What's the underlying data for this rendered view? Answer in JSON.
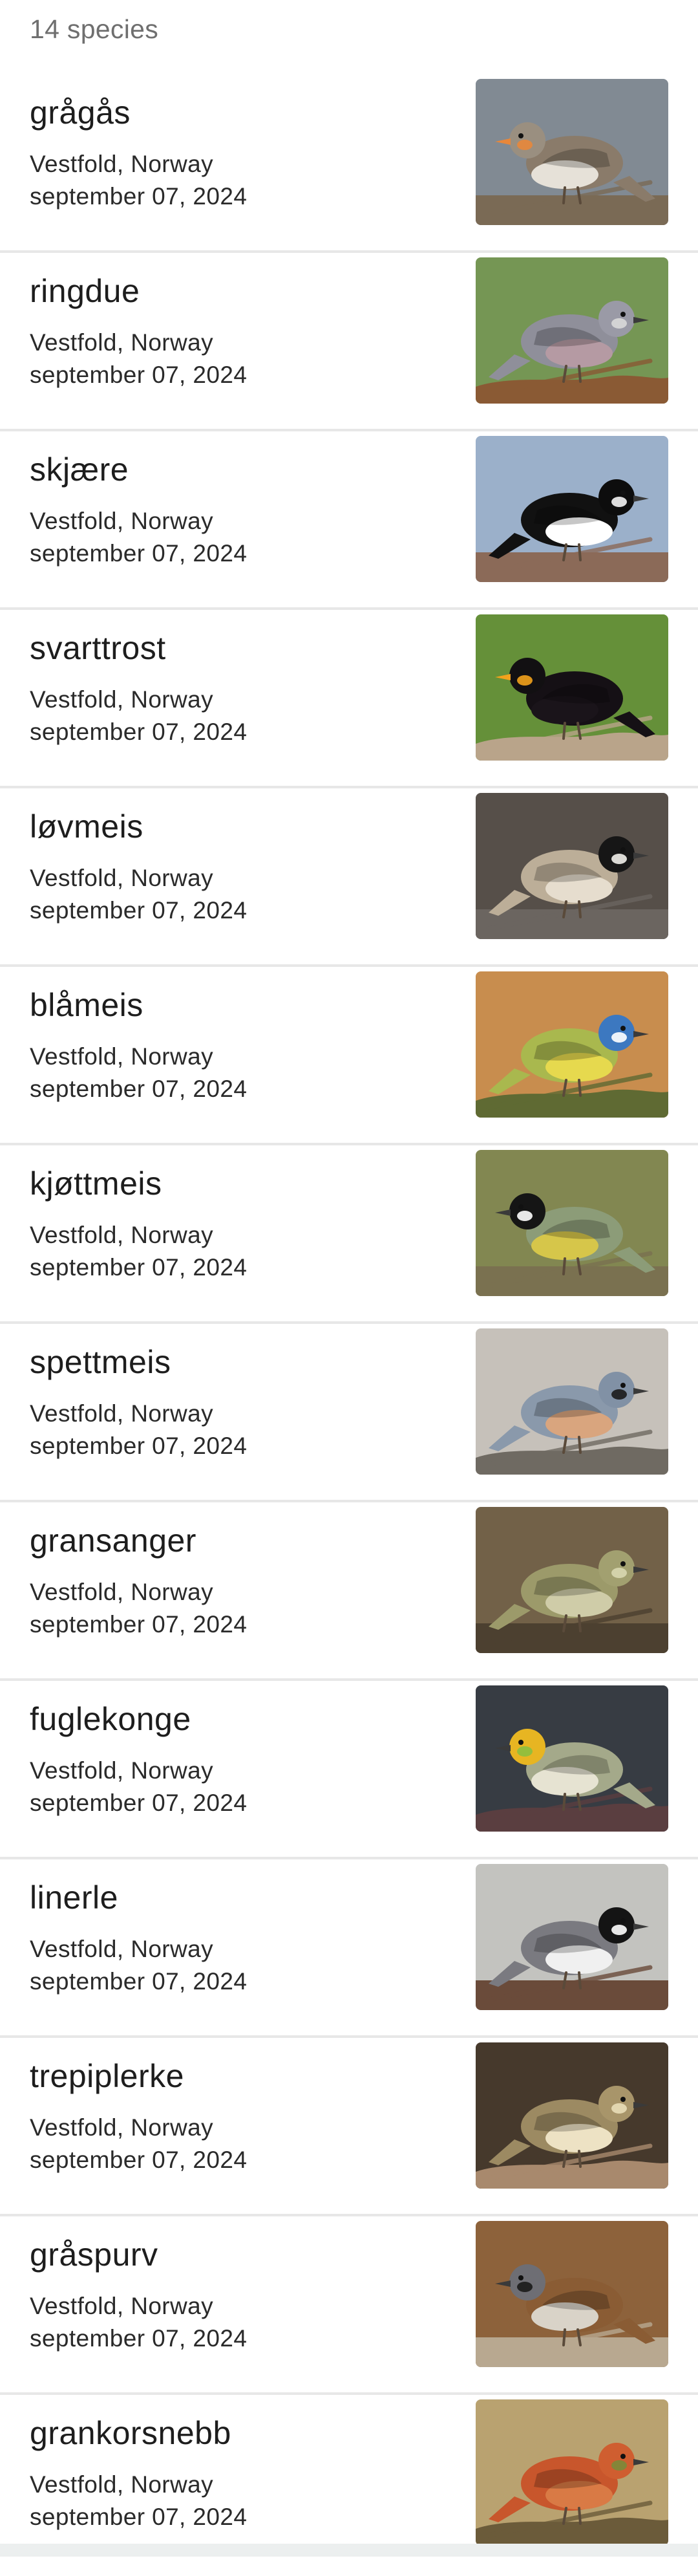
{
  "header": {
    "species_count": "14 species"
  },
  "species": [
    {
      "name": "grågås",
      "location": "Vestfold, Norway",
      "date": "september 07, 2024",
      "photo_icon": "greylag-goose-photo",
      "bg": "#8d96a0",
      "ground": "#7a6a55",
      "body": "#8a7b6a",
      "head": "#9a8f80",
      "accent": "#e8873a",
      "belly": "#e6e1d8"
    },
    {
      "name": "ringdue",
      "location": "Vestfold, Norway",
      "date": "september 07, 2024",
      "photo_icon": "wood-pigeon-photo",
      "bg": "#7fa35c",
      "ground": "#8a5a34",
      "body": "#8f8f9a",
      "head": "#9a9aa6",
      "accent": "#d9d9d9",
      "belly": "#b59aa3"
    },
    {
      "name": "skjære",
      "location": "Vestfold, Norway",
      "date": "september 07, 2024",
      "photo_icon": "magpie-photo",
      "bg": "#a9bfdc",
      "ground": "#8b6a58",
      "body": "#111111",
      "head": "#0d0d0d",
      "accent": "#f4f4f4",
      "belly": "#ffffff"
    },
    {
      "name": "svarttrost",
      "location": "Vestfold, Norway",
      "date": "september 07, 2024",
      "photo_icon": "blackbird-photo",
      "bg": "#6e9d3e",
      "ground": "#b9a48a",
      "body": "#151015",
      "head": "#121012",
      "accent": "#f2a21c",
      "belly": "#1a141a"
    },
    {
      "name": "løvmeis",
      "location": "Vestfold, Norway",
      "date": "september 07, 2024",
      "photo_icon": "marsh-tit-photo",
      "bg": "#5e5650",
      "ground": "#6b6560",
      "body": "#bcae98",
      "head": "#161616",
      "accent": "#f1efea",
      "belly": "#e6ddce"
    },
    {
      "name": "blåmeis",
      "location": "Vestfold, Norway",
      "date": "september 07, 2024",
      "photo_icon": "blue-tit-photo",
      "bg": "#d99a55",
      "ground": "#5f6a33",
      "body": "#a9b84e",
      "head": "#3c78c0",
      "accent": "#ffffff",
      "belly": "#e6d94e"
    },
    {
      "name": "kjøttmeis",
      "location": "Vestfold, Norway",
      "date": "september 07, 2024",
      "photo_icon": "great-tit-photo",
      "bg": "#8e9358",
      "ground": "#7a7150",
      "body": "#8c9c78",
      "head": "#151515",
      "accent": "#ffffff",
      "belly": "#d6c64a"
    },
    {
      "name": "spettmeis",
      "location": "Vestfold, Norway",
      "date": "september 07, 2024",
      "photo_icon": "nuthatch-photo",
      "bg": "#d7d2ca",
      "ground": "#6f6a62",
      "body": "#8a99ab",
      "head": "#8191a5",
      "accent": "#1b1b1b",
      "belly": "#d9a57e"
    },
    {
      "name": "gransanger",
      "location": "Vestfold, Norway",
      "date": "september 07, 2024",
      "photo_icon": "chiffchaff-photo",
      "bg": "#7c6a4f",
      "ground": "#4c4030",
      "body": "#9c9a6a",
      "head": "#a2a070",
      "accent": "#d8d7b0",
      "belly": "#cfcca8"
    },
    {
      "name": "fuglekonge",
      "location": "Vestfold, Norway",
      "date": "september 07, 2024",
      "photo_icon": "goldcrest-photo",
      "bg": "#3c4249",
      "ground": "#5a3e40",
      "body": "#a4a98a",
      "head": "#e7b522",
      "accent": "#8bbf3f",
      "belly": "#e6e3d2"
    },
    {
      "name": "linerle",
      "location": "Vestfold, Norway",
      "date": "september 07, 2024",
      "photo_icon": "white-wagtail-photo",
      "bg": "#d4d4d0",
      "ground": "#6a4b3a",
      "body": "#7a7a80",
      "head": "#141414",
      "accent": "#ffffff",
      "belly": "#f0f0f0"
    },
    {
      "name": "trepiplerke",
      "location": "Vestfold, Norway",
      "date": "september 07, 2024",
      "photo_icon": "tree-pipit-photo",
      "bg": "#4d3e30",
      "ground": "#a8896d",
      "body": "#9c8a62",
      "head": "#a8956a",
      "accent": "#e8ddb8",
      "belly": "#ede2c4"
    },
    {
      "name": "gråspurv",
      "location": "Vestfold, Norway",
      "date": "september 07, 2024",
      "photo_icon": "house-sparrow-photo",
      "bg": "#9a6b40",
      "ground": "#b8a890",
      "body": "#8a5c34",
      "head": "#6e6e74",
      "accent": "#1a1a1a",
      "belly": "#d9d3c8"
    },
    {
      "name": "grankorsnebb",
      "location": "Vestfold, Norway",
      "date": "september 07, 2024",
      "photo_icon": "common-crossbill-photo",
      "bg": "#c9b07a",
      "ground": "#6b5b3a",
      "body": "#c8562c",
      "head": "#cf5e30",
      "accent": "#7b8a3a",
      "belly": "#d97a45"
    }
  ]
}
